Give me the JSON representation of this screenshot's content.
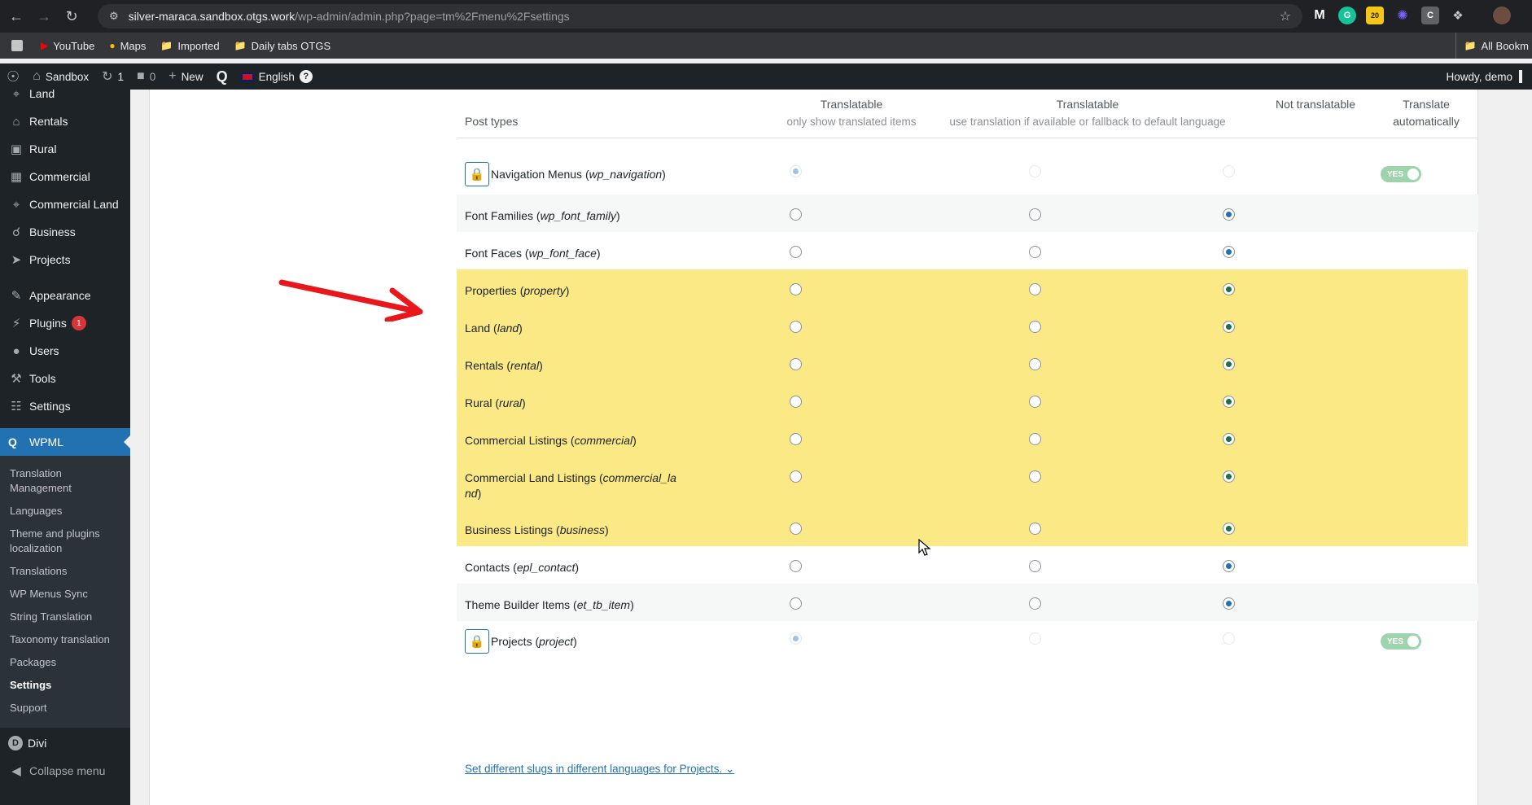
{
  "browser": {
    "url_host": "silver-maraca.sandbox.otgs.work",
    "url_path": "/wp-admin/admin.php?page=tm%2Fmenu%2Fsettings",
    "bookmarks": [
      "YouTube",
      "Maps",
      "Imported",
      "Daily tabs OTGS"
    ],
    "all_bookmarks": "All Bookm",
    "ext_badge": "20"
  },
  "adminbar": {
    "site": "Sandbox",
    "updates": "1",
    "comments": "0",
    "new": "New",
    "language": "English",
    "howdy": "Howdy, demo"
  },
  "sidebar": {
    "items": [
      {
        "label": "Land",
        "icon": "crop-icon"
      },
      {
        "label": "Rentals",
        "icon": "home-icon"
      },
      {
        "label": "Rural",
        "icon": "tractor-icon"
      },
      {
        "label": "Commercial",
        "icon": "building-icon"
      },
      {
        "label": "Commercial Land",
        "icon": "crop-icon"
      },
      {
        "label": "Business",
        "icon": "cart-icon"
      },
      {
        "label": "Projects",
        "icon": "pin-icon"
      }
    ],
    "items2": [
      {
        "label": "Appearance",
        "icon": "brush-icon"
      },
      {
        "label": "Plugins",
        "icon": "plugin-icon",
        "badge": "1"
      },
      {
        "label": "Users",
        "icon": "user-icon"
      },
      {
        "label": "Tools",
        "icon": "wrench-icon"
      },
      {
        "label": "Settings",
        "icon": "settings-icon"
      }
    ],
    "current": "WPML",
    "submenu": [
      "Translation Management",
      "Languages",
      "Theme and plugins localization",
      "Translations",
      "WP Menus Sync",
      "String Translation",
      "Taxonomy translation",
      "Packages",
      "Settings",
      "Support"
    ],
    "divi": "Divi",
    "collapse": "Collapse menu"
  },
  "table": {
    "col_post_types": "Post types",
    "col1_title": "Translatable",
    "col1_sub": "only show translated items",
    "col2_title": "Translatable",
    "col2_sub": "use translation if available or fallback to default language",
    "col3_title": "Not translatable",
    "col4_title_1": "Translate",
    "col4_title_2": "automatically",
    "rows": [
      {
        "name": "Navigation Menus (",
        "slug": "wp_navigation",
        "close": ")"
      },
      {
        "name": "Font Families (",
        "slug": "wp_font_family",
        "close": ")"
      },
      {
        "name": "Font Faces (",
        "slug": "wp_font_face",
        "close": ")"
      },
      {
        "name": "Properties (",
        "slug": "property",
        "close": ")"
      },
      {
        "name": "Land (",
        "slug": "land",
        "close": ")"
      },
      {
        "name": "Rentals (",
        "slug": "rental",
        "close": ")"
      },
      {
        "name": "Rural (",
        "slug": "rural",
        "close": ")"
      },
      {
        "name": "Commercial Listings (",
        "slug": "commercial",
        "close": ")"
      },
      {
        "name": "Commercial Land Listings (",
        "slug": "commercial_la",
        "slug2": "nd",
        "close": ")"
      },
      {
        "name": "Business Listings (",
        "slug": "business",
        "close": ")"
      },
      {
        "name": "Contacts (",
        "slug": "epl_contact",
        "close": ")"
      },
      {
        "name": "Theme Builder Items (",
        "slug": "et_tb_item",
        "close": ")"
      },
      {
        "name": "Projects (",
        "slug": "project",
        "close": ")"
      }
    ],
    "toggle_yes": "YES",
    "slug_link": "Set different slugs in different languages for Projects."
  },
  "colors": {
    "highlight": "#fbe985",
    "wp_blue": "#2271b1",
    "arrow": "#e8171b"
  }
}
